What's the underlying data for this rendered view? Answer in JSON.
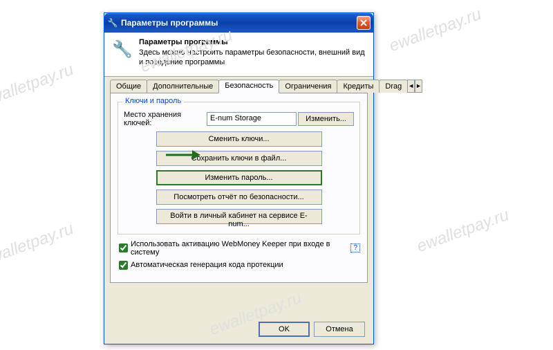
{
  "watermark": "ewalletpay.ru",
  "dialog": {
    "title": "Параметры программы",
    "header": {
      "title": "Параметры программы",
      "description": "Здесь можно настроить параметры безопасности, внешний вид и поведение программы"
    },
    "tabs": {
      "items": [
        {
          "label": "Общие",
          "active": false
        },
        {
          "label": "Дополнительные",
          "active": false
        },
        {
          "label": "Безопасность",
          "active": true
        },
        {
          "label": "Ограничения",
          "active": false
        },
        {
          "label": "Кредиты",
          "active": false
        },
        {
          "label": "Drag",
          "active": false
        }
      ],
      "scrollLeft": "◄",
      "scrollRight": "►"
    },
    "securityTab": {
      "groupTitle": "Ключи и пароль",
      "keyLocationLabel": "Место хранения ключей:",
      "keyLocationValue": "E-num Storage",
      "changeBtn": "Изменить...",
      "actions": [
        {
          "label": "Сменить ключи...",
          "highlighted": false
        },
        {
          "label": "Сохранить ключи в файл...",
          "highlighted": false
        },
        {
          "label": "Изменить пароль...",
          "highlighted": true
        },
        {
          "label": "Посмотреть отчёт по безопасности...",
          "highlighted": false
        },
        {
          "label": "Войти в личный кабинет на сервисе E-num...",
          "highlighted": false
        }
      ],
      "checkbox1": {
        "label": "Использовать активацию WebMoney Keeper при входе в систему",
        "checked": true,
        "help": "?"
      },
      "checkbox2": {
        "label": "Автоматическая генерация кода протекции",
        "checked": true
      }
    },
    "footer": {
      "ok": "OK",
      "cancel": "Отмена"
    }
  }
}
